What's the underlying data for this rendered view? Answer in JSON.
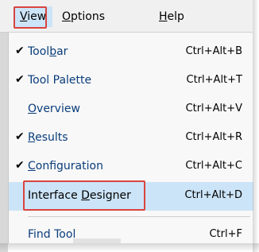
{
  "menubar": {
    "items": [
      {
        "pre": "",
        "ul": "V",
        "post": "iew"
      },
      {
        "pre": "",
        "ul": "O",
        "post": "ptions"
      },
      {
        "pre": "",
        "ul": "H",
        "post": "elp"
      }
    ]
  },
  "menu": {
    "items": [
      {
        "checked": true,
        "pre": "Tool",
        "ul": "b",
        "post": "ar",
        "shortcut": "Ctrl+Alt+B"
      },
      {
        "checked": true,
        "pre": "Tool Palette",
        "ul": "",
        "post": "",
        "shortcut": "Ctrl+Alt+T"
      },
      {
        "checked": false,
        "pre": "",
        "ul": "O",
        "post": "verview",
        "shortcut": "Ctrl+Alt+V"
      },
      {
        "checked": true,
        "pre": "",
        "ul": "R",
        "post": "esults",
        "shortcut": "Ctrl+Alt+R"
      },
      {
        "checked": true,
        "pre": "",
        "ul": "C",
        "post": "onfiguration",
        "shortcut": "Ctrl+Alt+C"
      },
      {
        "checked": false,
        "pre": "Interface ",
        "ul": "D",
        "post": "esigner",
        "shortcut": "Ctrl+Alt+D",
        "highlighted": true
      },
      {
        "checked": false,
        "pre": "Find Tool",
        "ul": "",
        "post": "",
        "shortcut": "Ctrl+F"
      }
    ]
  },
  "check_glyph": "✔",
  "colors": {
    "highlight": "#cce4f7",
    "label_blue": "#0a3d7a",
    "annotation_red": "#d9443f"
  }
}
